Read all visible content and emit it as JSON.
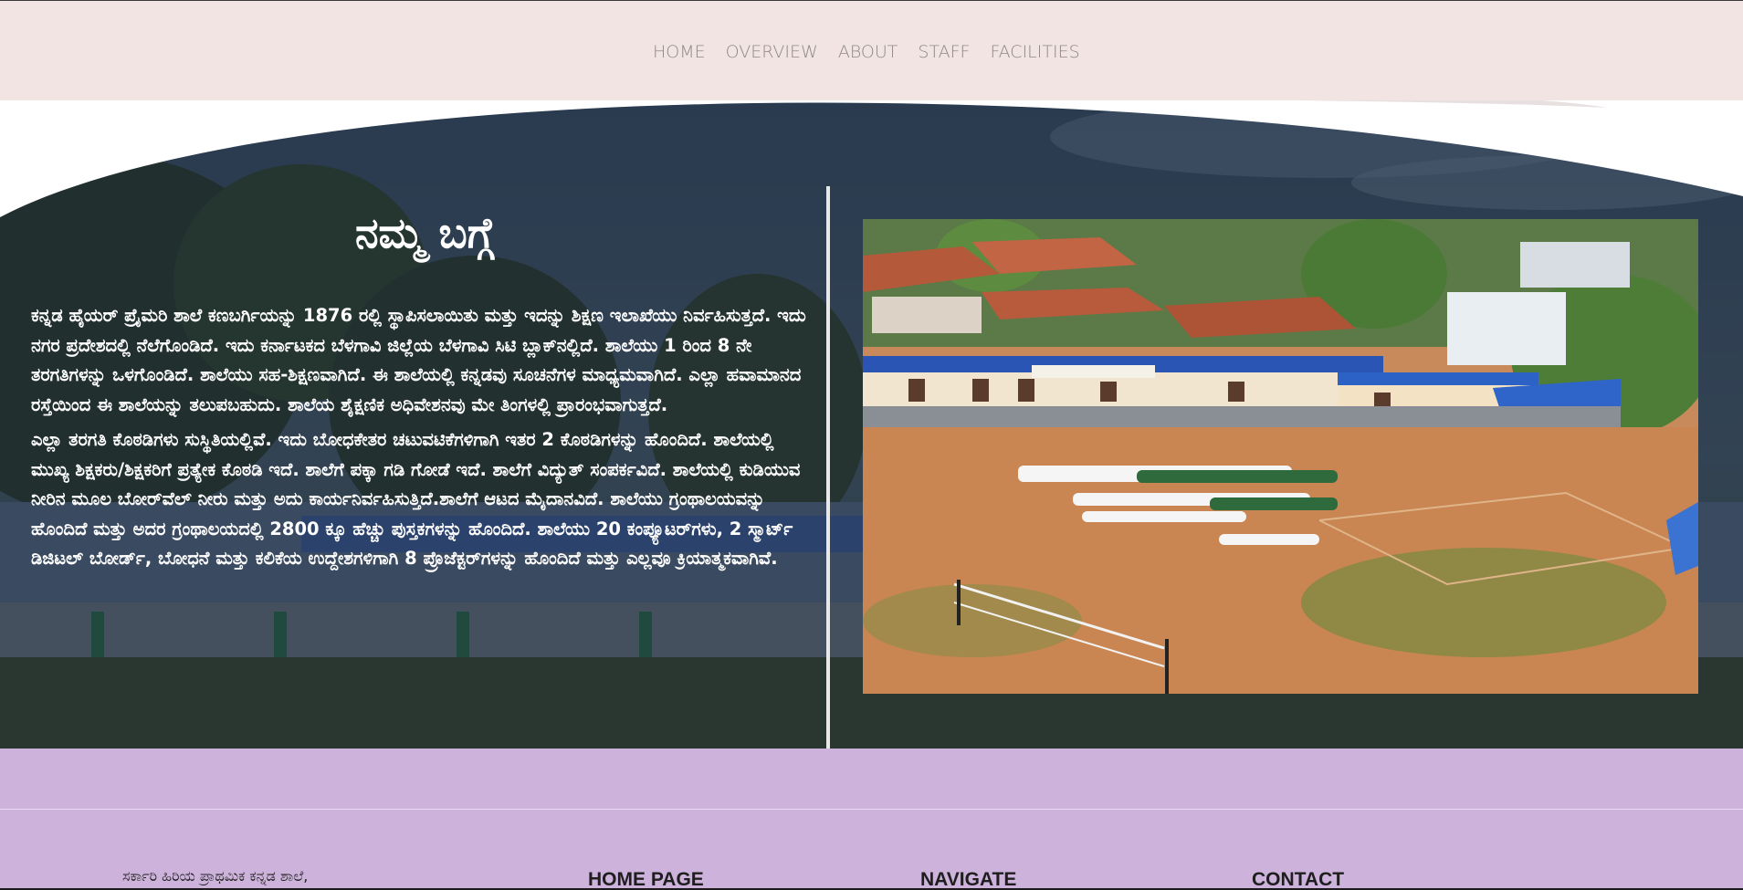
{
  "nav": {
    "items": [
      {
        "label": "HOME"
      },
      {
        "label": "OVERVIEW"
      },
      {
        "label": "ABOUT"
      },
      {
        "label": "STAFF"
      },
      {
        "label": "FACILITIES"
      }
    ]
  },
  "about": {
    "title": "ನಮ್ಮ ಬಗ್ಗೆ",
    "paragraph_1": "ಕನ್ನಡ ಹೈಯರ್ ಪ್ರೈಮರಿ ಶಾಲೆ ಕಣಬರ್ಗಿಯನ್ನು 1876 ರಲ್ಲಿ ಸ್ಥಾಪಿಸಲಾಯಿತು ಮತ್ತು ಇದನ್ನು ಶಿಕ್ಷಣ ಇಲಾಖೆಯು ನಿರ್ವಹಿಸುತ್ತದೆ. ಇದು ನಗರ ಪ್ರದೇಶದಲ್ಲಿ ನೆಲೆಗೊಂಡಿದೆ. ಇದು ಕರ್ನಾಟಕದ ಬೆಳಗಾವಿ ಜಿಲ್ಲೆಯ ಬೆಳಗಾವಿ ಸಿಟಿ ಬ್ಲಾಕ್‌ನಲ್ಲಿದೆ. ಶಾಲೆಯು 1 ರಿಂದ 8 ನೇ ತರಗತಿಗಳನ್ನು ಒಳಗೊಂಡಿದೆ. ಶಾಲೆಯು ಸಹ-ಶಿಕ್ಷಣವಾಗಿದೆ. ಈ ಶಾಲೆಯಲ್ಲಿ ಕನ್ನಡವು ಸೂಚನೆಗಳ ಮಾಧ್ಯಮವಾಗಿದೆ. ಎಲ್ಲಾ ಹವಾಮಾನದ ರಸ್ತೆಯಿಂದ ಈ ಶಾಲೆಯನ್ನು ತಲುಪಬಹುದು. ಶಾಲೆಯ ಶೈಕ್ಷಣಿಕ ಅಧಿವೇಶನವು ಮೇ ತಿಂಗಳಲ್ಲಿ ಪ್ರಾರಂಭವಾಗುತ್ತದೆ.",
    "paragraph_2": "ಎಲ್ಲಾ ತರಗತಿ ಕೊಠಡಿಗಳು ಸುಸ್ಥಿತಿಯಲ್ಲಿವೆ. ಇದು ಬೋಧಕೇತರ ಚಟುವಟಿಕೆಗಳಿಗಾಗಿ ಇತರ 2 ಕೊಠಡಿಗಳನ್ನು ಹೊಂದಿದೆ. ಶಾಲೆಯಲ್ಲಿ ಮುಖ್ಯ ಶಿಕ್ಷಕರು/ಶಿಕ್ಷಕರಿಗೆ ಪ್ರತ್ಯೇಕ ಕೊಠಡಿ ಇದೆ. ಶಾಲೆಗೆ ಪಕ್ಕಾ ಗಡಿ ಗೋಡೆ ಇದೆ. ಶಾಲೆಗೆ ವಿದ್ಯುತ್ ಸಂಪರ್ಕವಿದೆ. ಶಾಲೆಯಲ್ಲಿ ಕುಡಿಯುವ ನೀರಿನ ಮೂಲ ಬೋರ್‌ವೆಲ್ ನೀರು ಮತ್ತು ಅದು ಕಾರ್ಯನಿರ್ವಹಿಸುತ್ತಿದೆ.ಶಾಲೆಗೆ ಆಟದ ಮೈದಾನವಿದೆ. ಶಾಲೆಯು ಗ್ರಂಥಾಲಯವನ್ನು ಹೊಂದಿದೆ ಮತ್ತು ಅದರ ಗ್ರಂಥಾಲಯದಲ್ಲಿ 2800 ಕ್ಕೂ ಹೆಚ್ಚು ಪುಸ್ತಕಗಳನ್ನು ಹೊಂದಿದೆ. ಶಾಲೆಯು 20 ಕಂಪ್ಯೂಟರ್‌ಗಳು, 2 ಸ್ಮಾರ್ಟ್ ಡಿಜಿಟಲ್ ಬೋರ್ಡ್, ಬೋಧನೆ ಮತ್ತು ಕಲಿಕೆಯ ಉದ್ದೇಶಗಳಿಗಾಗಿ 8 ಪ್ರೊಜೆಕ್ಟರ್‌ಗಳನ್ನು ಹೊಂದಿದೆ ಮತ್ತು ಎಲ್ಲವೂ ಕ್ರಿಯಾತ್ಮಕವಾಗಿವೆ."
  },
  "footer": {
    "address_line": "ಸರ್ಕಾರಿ ಹಿರಿಯ ಪ್ರಾಥಮಿಕ ಕನ್ನಡ ಶಾಲೆ,",
    "home_page": "HOME PAGE",
    "navigate": "NAVIGATE",
    "contact": "CONTACT"
  },
  "colors": {
    "header_bg": "#f1e4e3",
    "footer_bg": "#cdb3dc",
    "hero_overlay": "#142132",
    "nav_text": "#8f8888"
  }
}
